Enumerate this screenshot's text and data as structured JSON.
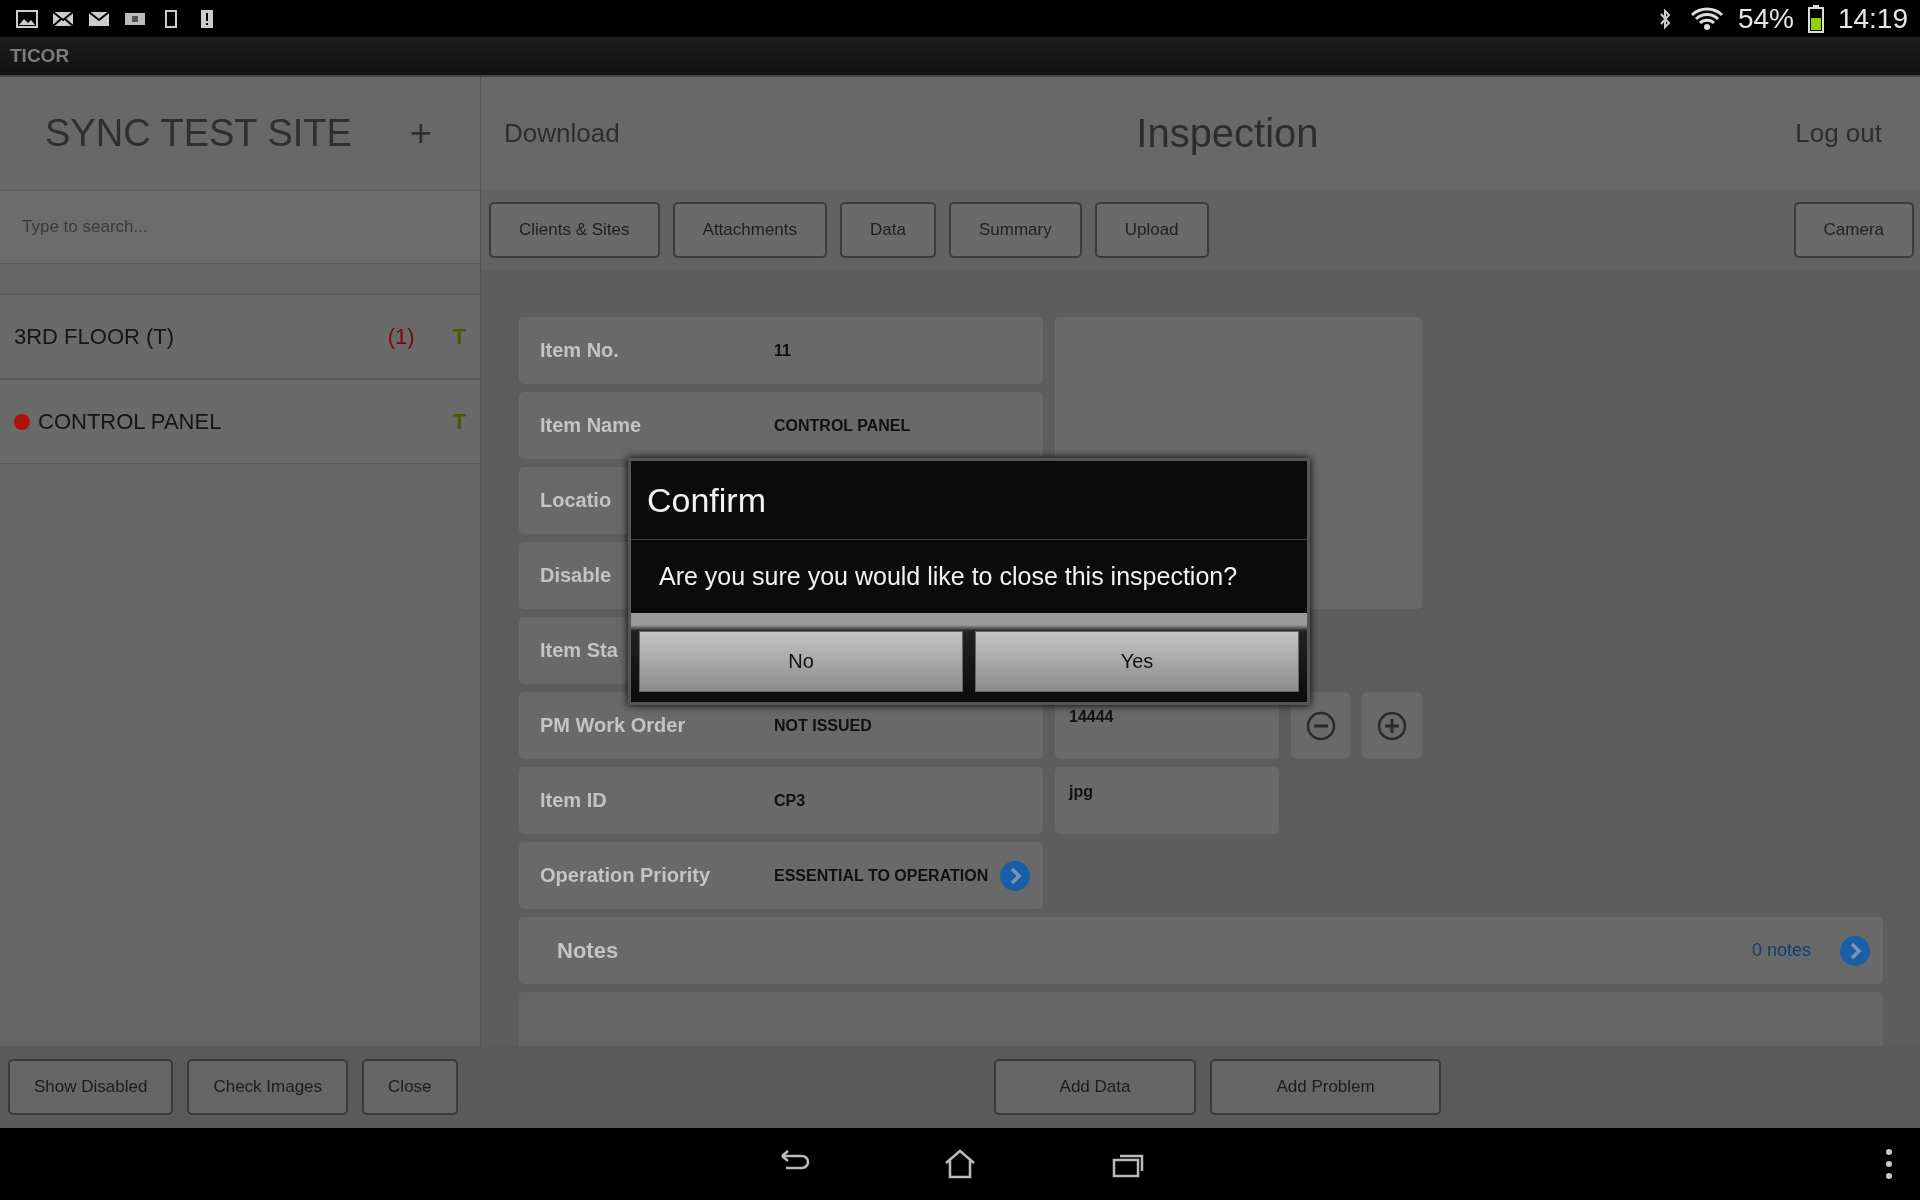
{
  "status_bar": {
    "battery": "54%",
    "time": "14:19"
  },
  "app_bar": {
    "title": "TICOR"
  },
  "sidebar": {
    "site_title": "SYNC TEST SITE",
    "add_label": "+",
    "search": {
      "placeholder": "Type to search..."
    },
    "items": [
      {
        "label": "3RD FLOOR (T)",
        "count": "(1)",
        "tag": "T",
        "selected": false
      },
      {
        "label": "CONTROL PANEL",
        "tag": "T",
        "color": "#b01010",
        "selected": false
      }
    ]
  },
  "header": {
    "left_link": "Download",
    "title": "Inspection",
    "right_link": "Log out"
  },
  "toolbar": {
    "buttons": [
      "Clients & Sites",
      "Attachments",
      "Data",
      "Summary",
      "Upload"
    ],
    "right_button": "Camera"
  },
  "fields": [
    {
      "label": "Item No.",
      "value": "11",
      "kind": "text"
    },
    {
      "label": "Item Name",
      "value": "CONTROL PANEL",
      "kind": "text"
    },
    {
      "label": "Locatio",
      "kind": "text"
    },
    {
      "label": "Disable",
      "kind": "text"
    },
    {
      "label": "Item Sta",
      "kind": "text"
    },
    {
      "label": "PM Work Order",
      "value": "NOT ISSUED",
      "kind": "text"
    },
    {
      "label": "Item ID",
      "value": "CP3",
      "kind": "text"
    },
    {
      "label": "Operation Priority",
      "value": "ESSENTIAL TO OPERATION",
      "kind": "select"
    }
  ],
  "side_fields": {
    "number": "14444",
    "extension": "jpg"
  },
  "notes": {
    "label": "Notes",
    "count": "0 notes"
  },
  "bottom_bar": {
    "left_buttons": [
      "Show Disabled",
      "Check Images",
      "Close"
    ],
    "right_buttons": [
      "Add Data",
      "Add Problem"
    ]
  },
  "dialog": {
    "title": "Confirm",
    "message": "Are you sure you would like to close this inspection?",
    "buttons": [
      "No",
      "Yes"
    ]
  }
}
